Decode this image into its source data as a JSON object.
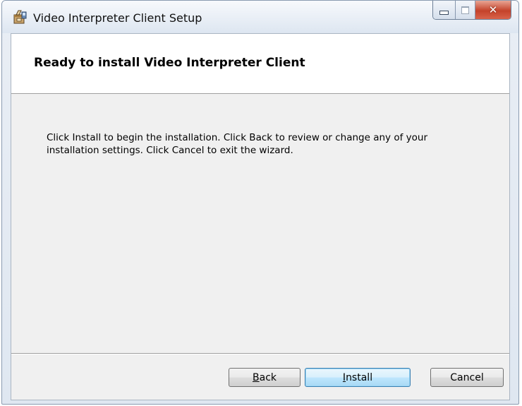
{
  "window": {
    "title": "Video Interpreter Client Setup",
    "icon": "installer-package-icon",
    "controls": {
      "minimize_icon": "minimize-icon",
      "maximize_icon": "maximize-icon",
      "close_label": "✕"
    }
  },
  "banner": {
    "title": "Ready to install Video Interpreter Client"
  },
  "body": {
    "text": "Click Install to begin the installation. Click Back to review or change any of your installation settings. Click Cancel to exit the wizard."
  },
  "buttons": {
    "back": {
      "mnemonic": "B",
      "rest": "ack"
    },
    "install": {
      "mnemonic": "I",
      "rest": "nstall"
    },
    "cancel": "Cancel"
  },
  "colors": {
    "close_button": "#c4422a",
    "default_button_border": "#3c7fb1",
    "dialog_background": "#f0f0f0"
  }
}
